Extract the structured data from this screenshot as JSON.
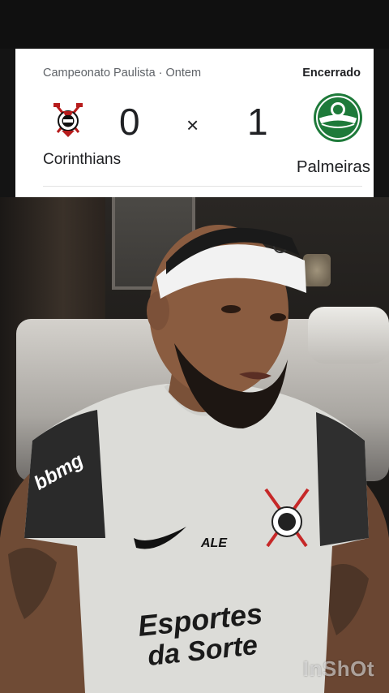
{
  "match": {
    "competition_line": "Campeonato Paulista · Ontem",
    "status": "Encerrado",
    "home": {
      "name": "Corinthians",
      "score": "0",
      "logo_icon": "corinthians-crest-icon"
    },
    "away": {
      "name": "Palmeiras",
      "score": "1",
      "logo_icon": "palmeiras-crest-icon"
    },
    "separator": "×"
  },
  "video": {
    "watermark": "InShOt",
    "jersey": {
      "sponsor_line1": "Esportes",
      "sponsor_line2": "da Sorte",
      "sleeve": "bbmg",
      "maker": "ALE"
    }
  },
  "colors": {
    "card_bg": "#ffffff",
    "text_primary": "#202124",
    "text_secondary": "#5f6368",
    "palmeiras_green": "#1e7a3a"
  }
}
